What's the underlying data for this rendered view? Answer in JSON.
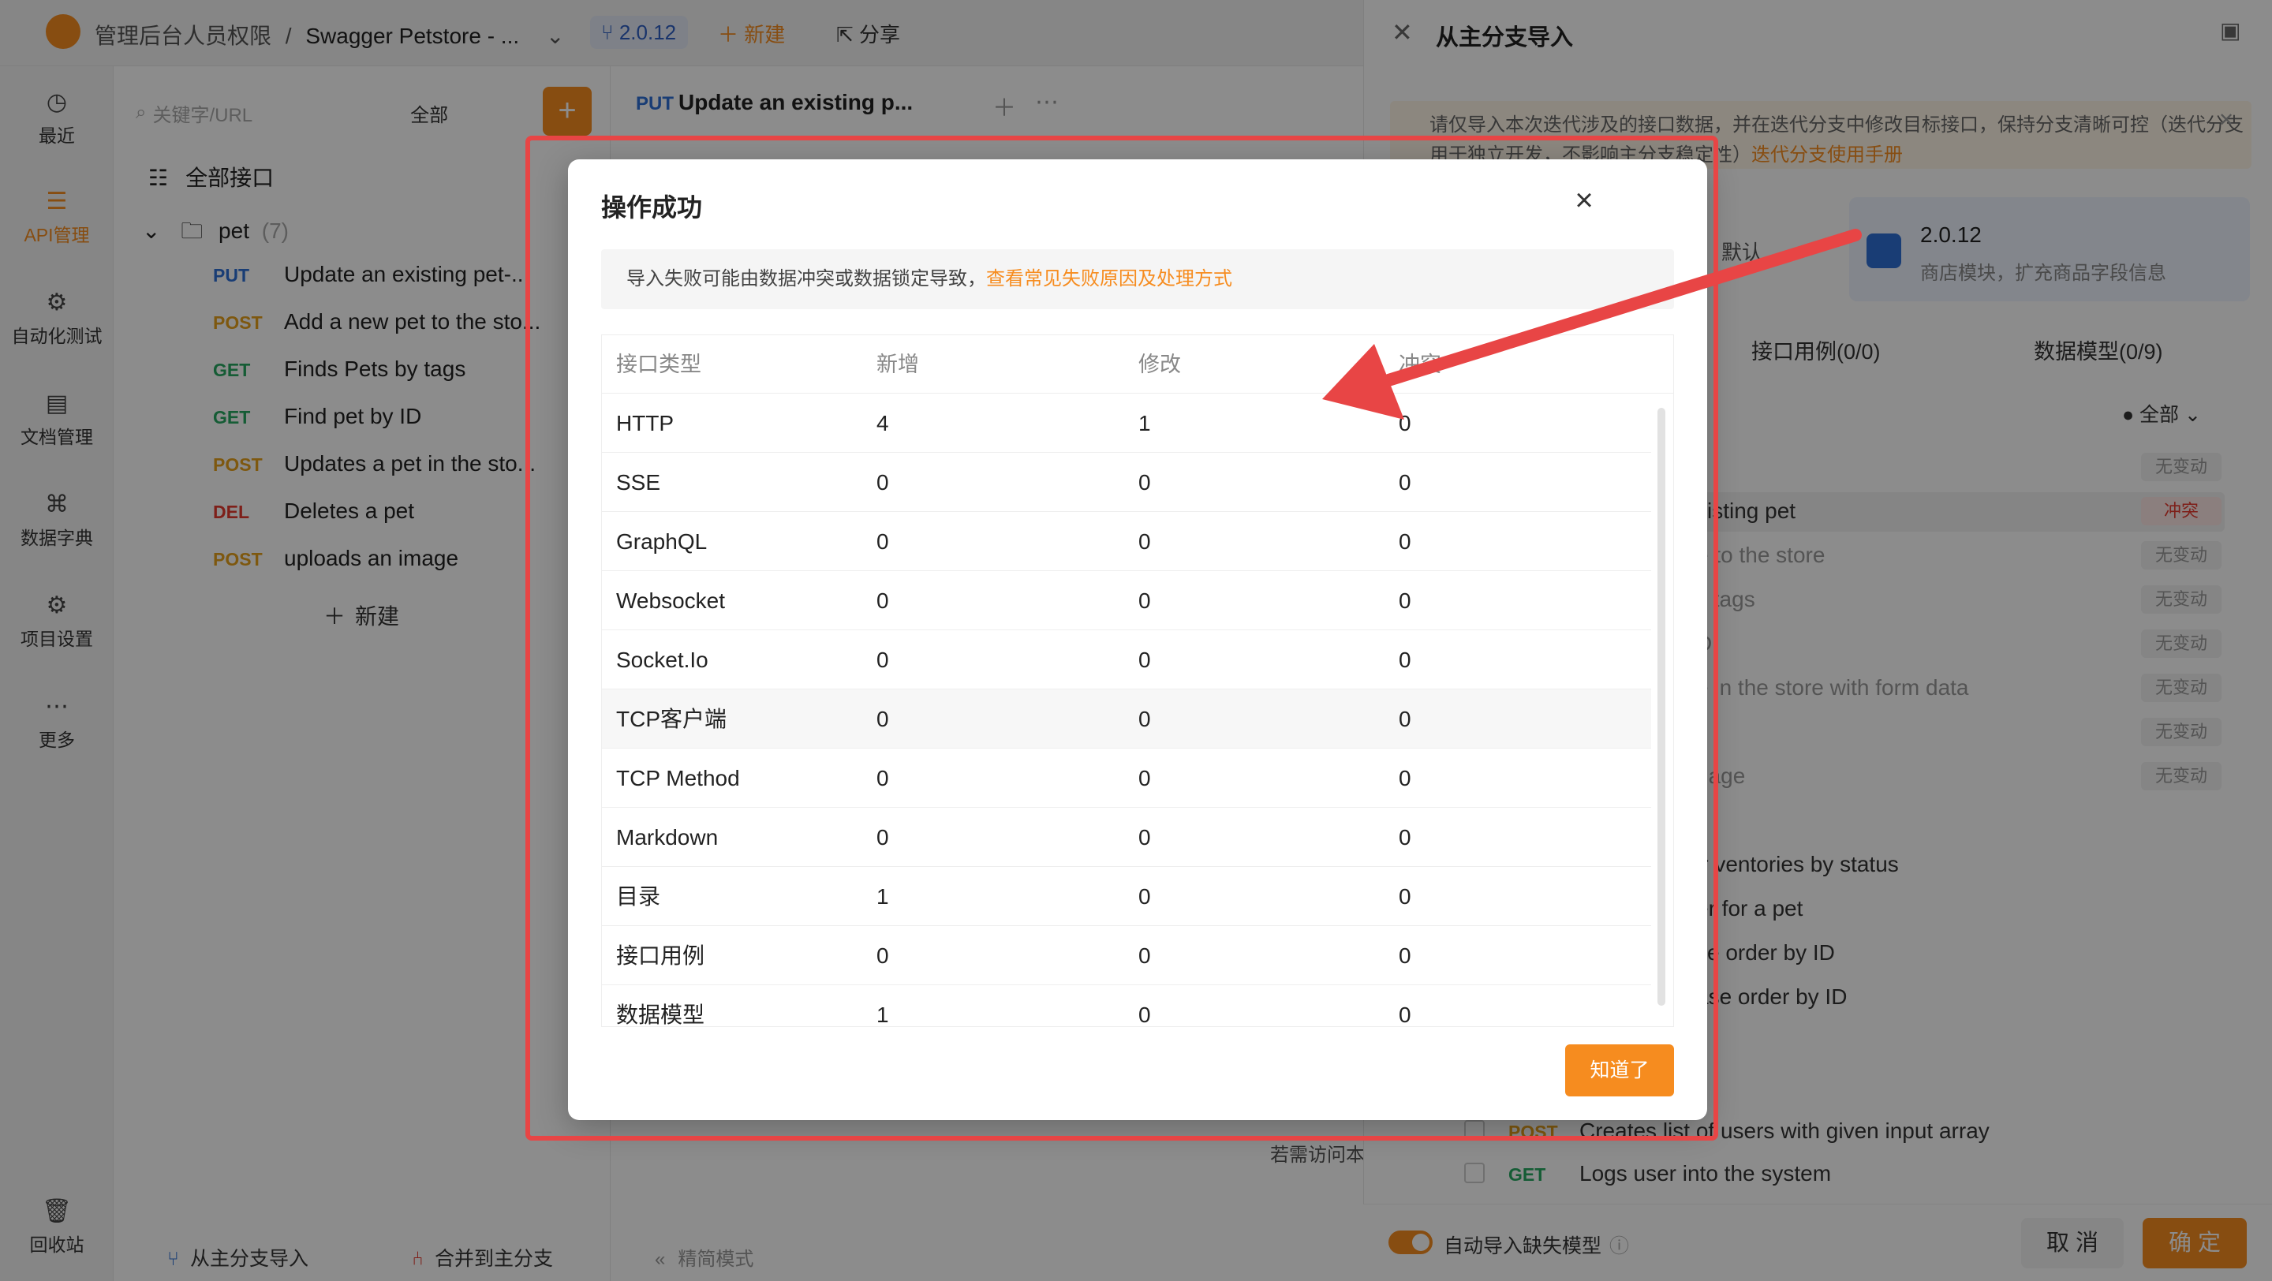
{
  "topbar": {
    "project": "管理后台人员权限",
    "separator": "/",
    "api_name": "Swagger Petstore - ...",
    "version": "2.0.12",
    "new_label": "新建",
    "share_label": "分享"
  },
  "sidebar": {
    "items": [
      {
        "label": "最近",
        "icon": "clock-icon"
      },
      {
        "label": "API管理",
        "icon": "api-icon"
      },
      {
        "label": "自动化测试",
        "icon": "automation-icon"
      },
      {
        "label": "文档管理",
        "icon": "document-icon"
      },
      {
        "label": "数据字典",
        "icon": "dictionary-icon"
      },
      {
        "label": "项目设置",
        "icon": "settings-icon"
      },
      {
        "label": "更多",
        "icon": "more-icon"
      }
    ],
    "trash_label": "回收站"
  },
  "tree": {
    "search_placeholder": "关键字/URL",
    "filter_label": "全部",
    "all_label": "全部接口",
    "folder_name": "pet",
    "folder_count": "(7)",
    "items": [
      {
        "method": "PUT",
        "name": "Update an existing pet-..."
      },
      {
        "method": "POST",
        "name": "Add a new pet to the sto..."
      },
      {
        "method": "GET",
        "name": "Finds Pets by tags"
      },
      {
        "method": "GET",
        "name": "Find pet by ID"
      },
      {
        "method": "POST",
        "name": "Updates a pet in the sto..."
      },
      {
        "method": "DEL",
        "name": "Deletes a pet"
      },
      {
        "method": "POST",
        "name": "uploads an image"
      }
    ],
    "new_label": "新建",
    "import_label": "从主分支导入",
    "merge_label": "合并到主分支"
  },
  "center": {
    "tab_method": "PUT",
    "tab_title": "Update an existing p...",
    "mode_label": "精简模式",
    "partial_text": "若需访问本"
  },
  "right_panel": {
    "title": "从主分支导入",
    "notice": "请仅导入本次迭代涉及的接口数据，并在迭代分支中修改目标接口，保持分支清晰可控（迭代分支用于独立开发，不影响主分支稳定性）",
    "notice_link": "迭代分支使用手册",
    "default_label": "默认",
    "version_name": "2.0.12",
    "version_desc": "商店模块，扩充商品字段信息",
    "tab_cases": "接口用例(0/0)",
    "tab_models": "数据模型(0/9)",
    "filter_label": "全部",
    "rows": [
      {
        "text": "",
        "badge": "无变动"
      },
      {
        "text": "xisting pet",
        "badge": "冲突"
      },
      {
        "text": "e to the store",
        "badge": "无变动"
      },
      {
        "text": "y tags",
        "badge": "无变动"
      },
      {
        "text": "D",
        "badge": "无变动"
      },
      {
        "text": "e in the store with form data",
        "badge": "无变动"
      },
      {
        "text": "t",
        "badge": "无变动"
      },
      {
        "text": "nage",
        "badge": "无变动"
      }
    ],
    "more_rows": [
      "ir ventories by status",
      "er for a pet",
      "se order by ID",
      "ase order by ID"
    ],
    "bottom_rows": [
      {
        "method": "POST",
        "text": "Creates list of users with given input array"
      },
      {
        "method": "GET",
        "text": "Logs user into the system"
      }
    ],
    "auto_import_label": "自动导入缺失模型",
    "cancel_label": "取 消",
    "confirm_label": "确 定"
  },
  "modal": {
    "title": "操作成功",
    "tip_text": "导入失败可能由数据冲突或数据锁定导致，",
    "tip_link": "查看常见失败原因及处理方式",
    "columns": [
      "接口类型",
      "新增",
      "修改",
      "冲突"
    ],
    "rows": [
      {
        "type": "HTTP",
        "added": "4",
        "modified": "1",
        "conflict": "0"
      },
      {
        "type": "SSE",
        "added": "0",
        "modified": "0",
        "conflict": "0"
      },
      {
        "type": "GraphQL",
        "added": "0",
        "modified": "0",
        "conflict": "0"
      },
      {
        "type": "Websocket",
        "added": "0",
        "modified": "0",
        "conflict": "0"
      },
      {
        "type": "Socket.Io",
        "added": "0",
        "modified": "0",
        "conflict": "0"
      },
      {
        "type": "TCP客户端",
        "added": "0",
        "modified": "0",
        "conflict": "0"
      },
      {
        "type": "TCP Method",
        "added": "0",
        "modified": "0",
        "conflict": "0"
      },
      {
        "type": "Markdown",
        "added": "0",
        "modified": "0",
        "conflict": "0"
      },
      {
        "type": "目录",
        "added": "1",
        "modified": "0",
        "conflict": "0"
      },
      {
        "type": "接口用例",
        "added": "0",
        "modified": "0",
        "conflict": "0"
      },
      {
        "type": "数据模型",
        "added": "1",
        "modified": "0",
        "conflict": "0"
      }
    ],
    "ok_label": "知道了"
  },
  "colors": {
    "accent": "#f68c1f",
    "annotation": "#e84545",
    "put": "#2f6fd6",
    "post": "#e5a01c",
    "get": "#27a862",
    "del": "#e5392e"
  }
}
